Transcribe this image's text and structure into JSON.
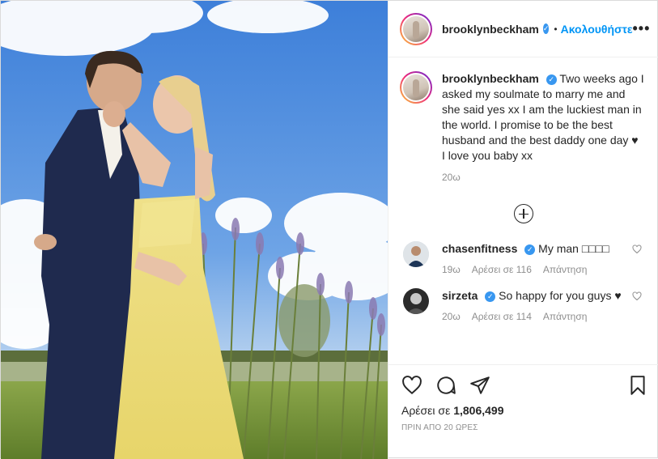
{
  "header": {
    "username": "brooklynbeckham",
    "follow_label": "Ακολουθήστε",
    "separator": "•",
    "more_label": "•••"
  },
  "caption": {
    "username": "brooklynbeckham",
    "text": "Two weeks ago I asked my soulmate to marry me and she said yes xx I am the luckiest man in the world. I promise to be the best husband and the best daddy one day ♥ I love you baby xx",
    "time": "20ω"
  },
  "comments": [
    {
      "username": "chasenfitness",
      "text": "My man □□□□",
      "time": "19ω",
      "likes": "Αρέσει σε 116",
      "reply": "Απάντηση"
    },
    {
      "username": "sirzeta",
      "text": "So happy for you guys ♥",
      "time": "20ω",
      "likes": "Αρέσει σε 114",
      "reply": "Απάντηση"
    }
  ],
  "actions": {
    "likes_prefix": "Αρέσει σε",
    "likes_count": "1,806,499",
    "ago": "ΠΡΙΝ ΑΠΟ 20 ΩΡΕΣ"
  },
  "colors": {
    "link": "#0095f6",
    "verified": "#3897f0",
    "muted": "#8e8e8e"
  },
  "icons": [
    "verified-badge-icon",
    "more-options-icon",
    "load-more-icon",
    "heart-icon",
    "comment-icon",
    "share-icon",
    "bookmark-icon"
  ]
}
